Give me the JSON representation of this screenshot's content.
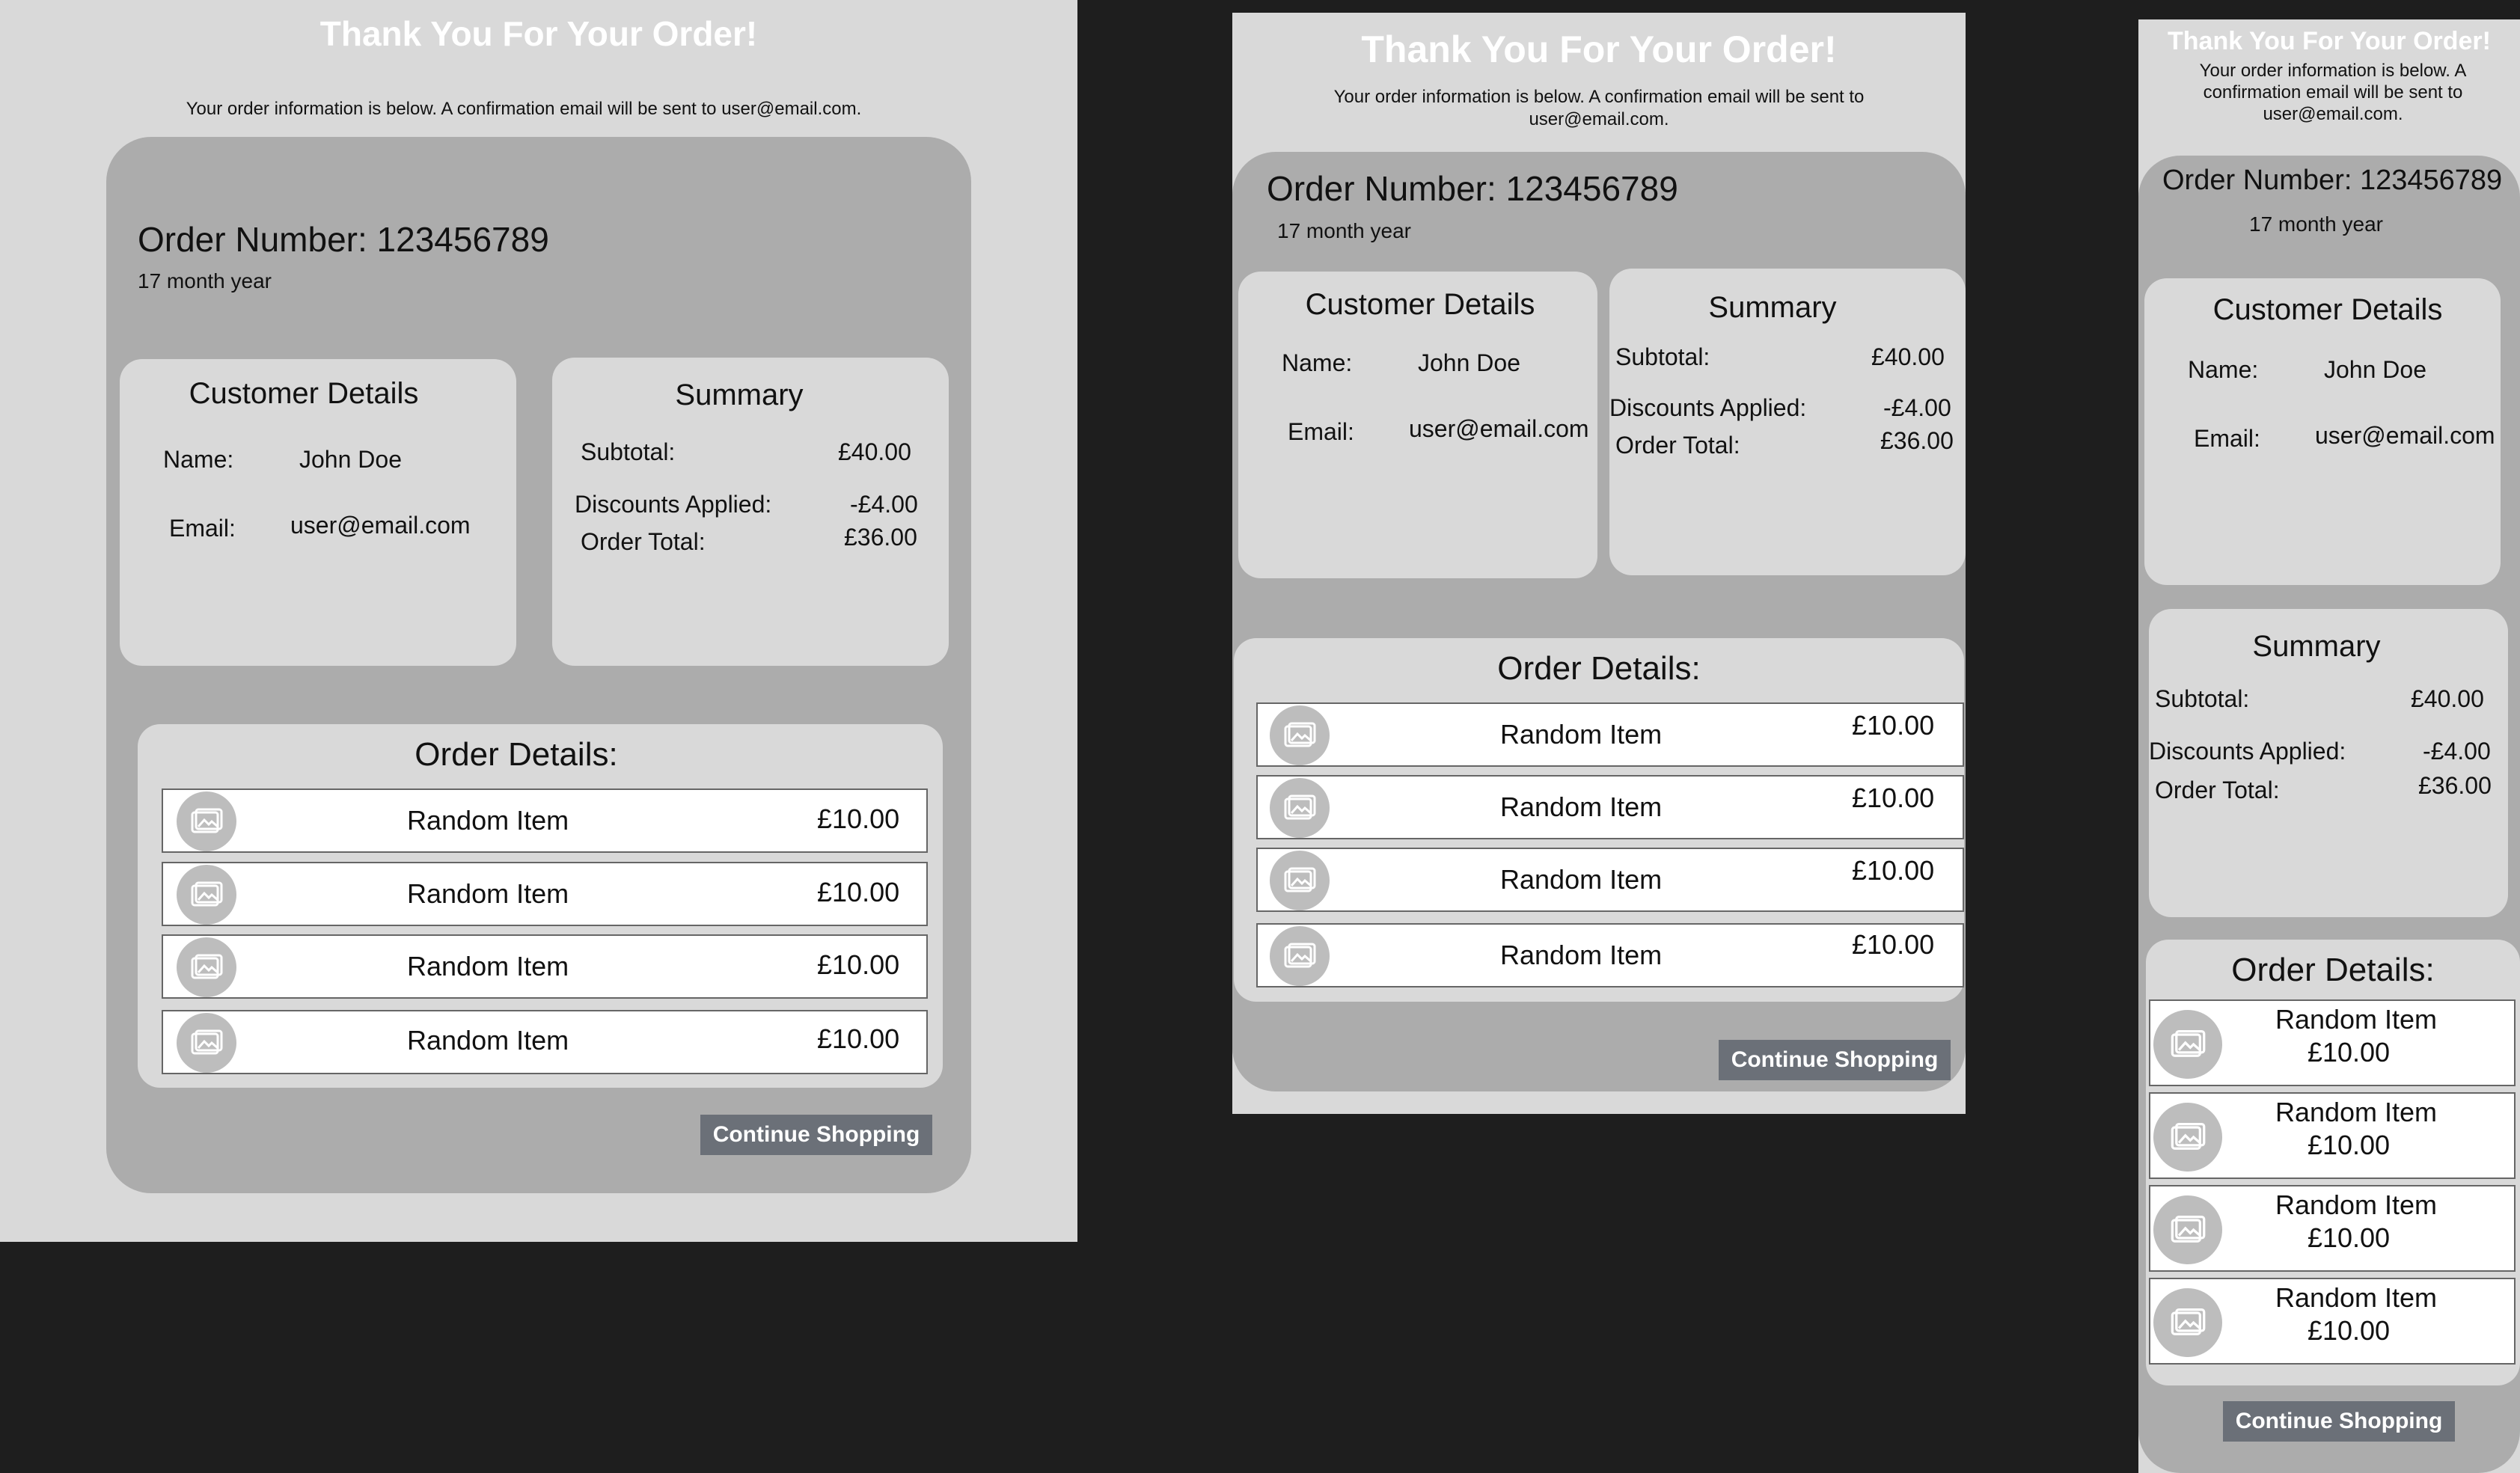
{
  "page": {
    "title": "Thank You For Your Order!",
    "intro": "Your order information is below. A confirmation email will be sent to user@email.com."
  },
  "order": {
    "number_label": "Order Number: 123456789",
    "date": "17 month year"
  },
  "customer": {
    "heading": "Customer Details",
    "name_label": "Name:",
    "name_value": "John Doe",
    "email_label": "Email:",
    "email_value": "user@email.com"
  },
  "summary": {
    "heading": "Summary",
    "subtotal_label": "Subtotal:",
    "subtotal_value": "£40.00",
    "discounts_label": "Discounts Applied:",
    "discounts_value": "-£4.00",
    "total_label": "Order Total:",
    "total_value": "£36.00"
  },
  "details": {
    "heading": "Order Details:",
    "items": [
      {
        "name": "Random Item",
        "price": "£10.00"
      },
      {
        "name": "Random Item",
        "price": "£10.00"
      },
      {
        "name": "Random Item",
        "price": "£10.00"
      },
      {
        "name": "Random Item",
        "price": "£10.00"
      }
    ]
  },
  "actions": {
    "continue_label": "Continue Shopping"
  },
  "colors": {
    "canvas": "#1e1e1e",
    "frame": "#d9d9d9",
    "panel": "#acacac",
    "button": "#6b7078"
  }
}
